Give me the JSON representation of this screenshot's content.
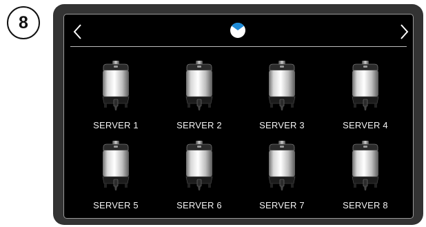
{
  "step": {
    "number": "8"
  },
  "header": {
    "prev_icon": "chevron-left-icon",
    "next_icon": "chevron-right-icon",
    "status_icon": "pie-status-icon",
    "accent_color": "#1e8ad6"
  },
  "servers": [
    {
      "label": "SERVER 1"
    },
    {
      "label": "SERVER 2"
    },
    {
      "label": "SERVER 3"
    },
    {
      "label": "SERVER 4"
    },
    {
      "label": "SERVER 5"
    },
    {
      "label": "SERVER 6"
    },
    {
      "label": "SERVER 7"
    },
    {
      "label": "SERVER 8"
    }
  ]
}
